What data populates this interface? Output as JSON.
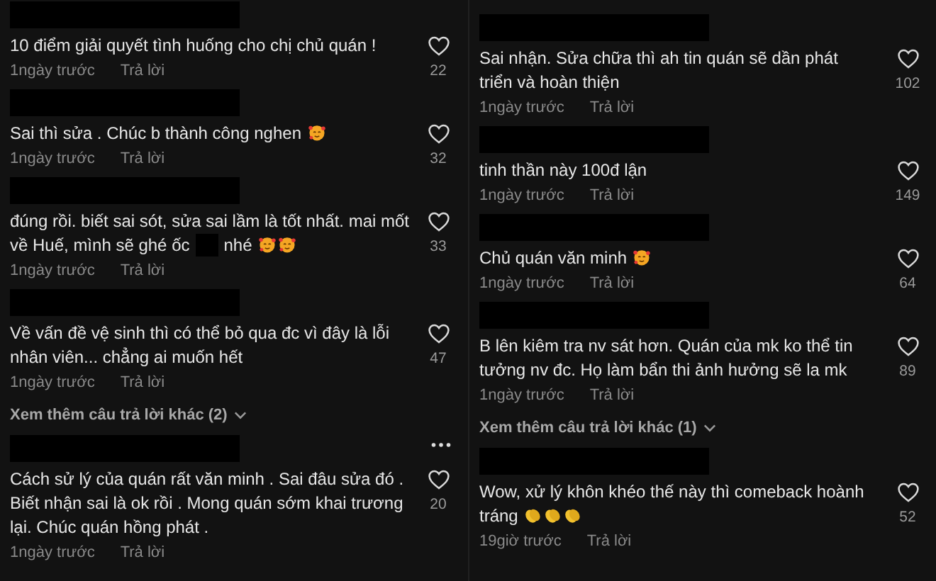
{
  "columns": [
    {
      "items": [
        {
          "kind": "comment",
          "menu": false,
          "segments": [
            {
              "kind": "text",
              "text": "10 điểm giải quyết tình huống cho chị chủ quán !"
            }
          ],
          "time": "1ngày trước",
          "reply": "Trả lời",
          "likes": "22"
        },
        {
          "kind": "comment",
          "menu": false,
          "segments": [
            {
              "kind": "text",
              "text": "Sai thì sửa . Chúc b thành công nghen"
            },
            {
              "kind": "smile"
            }
          ],
          "time": "1ngày trước",
          "reply": "Trả lời",
          "likes": "32"
        },
        {
          "kind": "comment",
          "menu": false,
          "segments": [
            {
              "kind": "text",
              "text": "đúng rồi. biết sai sót, sửa sai lầm là tốt nhất. mai mốt"
            },
            {
              "kind": "text",
              "text": "về Huế, mình sẽ ghé ốc"
            },
            {
              "kind": "redaction"
            },
            {
              "kind": "text",
              "text": "nhé"
            },
            {
              "kind": "smile"
            },
            {
              "kind": "smile"
            }
          ],
          "time": "1ngày trước",
          "reply": "Trả lời",
          "likes": "33"
        },
        {
          "kind": "comment",
          "menu": false,
          "segments": [
            {
              "kind": "text",
              "text": "Về vấn đề vệ sinh thì có thể bỏ qua đc vì đây là lỗi nhân viên... chẳng ai muốn hết"
            }
          ],
          "time": "1ngày trước",
          "reply": "Trả lời",
          "likes": "47"
        },
        {
          "kind": "more_replies",
          "text": "Xem thêm câu trả lời khác (2)"
        },
        {
          "kind": "comment",
          "menu": true,
          "segments": [
            {
              "kind": "text",
              "text": "Cách sử lý của quán rất văn minh . Sai đâu sửa đó . Biết nhận sai là ok rồi . Mong quán sớm khai trương lại. Chúc quán hồng phát ."
            }
          ],
          "time": "1ngày trước",
          "reply": "Trả lời",
          "likes": "20"
        }
      ]
    },
    {
      "items": [
        {
          "kind": "comment",
          "menu": false,
          "segments": [
            {
              "kind": "text",
              "text": "Sai nhận. Sửa chữa thì ah tin quán sẽ dần phát triển và hoàn thiện"
            }
          ],
          "time": "1ngày trước",
          "reply": "Trả lời",
          "likes": "102"
        },
        {
          "kind": "comment",
          "menu": false,
          "segments": [
            {
              "kind": "text",
              "text": "tinh thần này 100đ lận"
            }
          ],
          "time": "1ngày trước",
          "reply": "Trả lời",
          "likes": "149"
        },
        {
          "kind": "comment",
          "menu": false,
          "segments": [
            {
              "kind": "text",
              "text": "Chủ quán văn minh"
            },
            {
              "kind": "smile"
            }
          ],
          "time": "1ngày trước",
          "reply": "Trả lời",
          "likes": "64"
        },
        {
          "kind": "comment",
          "menu": false,
          "segments": [
            {
              "kind": "text",
              "text": "B lên kiêm tra nv sát hơn. Quán của mk ko thể tin tưởng nv đc. Họ làm bẩn thi ảnh hưởng sẽ la mk"
            }
          ],
          "time": "1ngày trước",
          "reply": "Trả lời",
          "likes": "89"
        },
        {
          "kind": "more_replies",
          "text": "Xem thêm câu trả lời khác (1)"
        },
        {
          "kind": "comment",
          "menu": false,
          "segments": [
            {
              "kind": "text",
              "text": "Wow, xử lý khôn khéo thế này thì comeback hoành"
            },
            {
              "kind": "text",
              "text": "tráng"
            },
            {
              "kind": "clap"
            },
            {
              "kind": "clap"
            },
            {
              "kind": "clap"
            }
          ],
          "time": "19giờ trước",
          "reply": "Trả lời",
          "likes": "52"
        }
      ]
    }
  ]
}
